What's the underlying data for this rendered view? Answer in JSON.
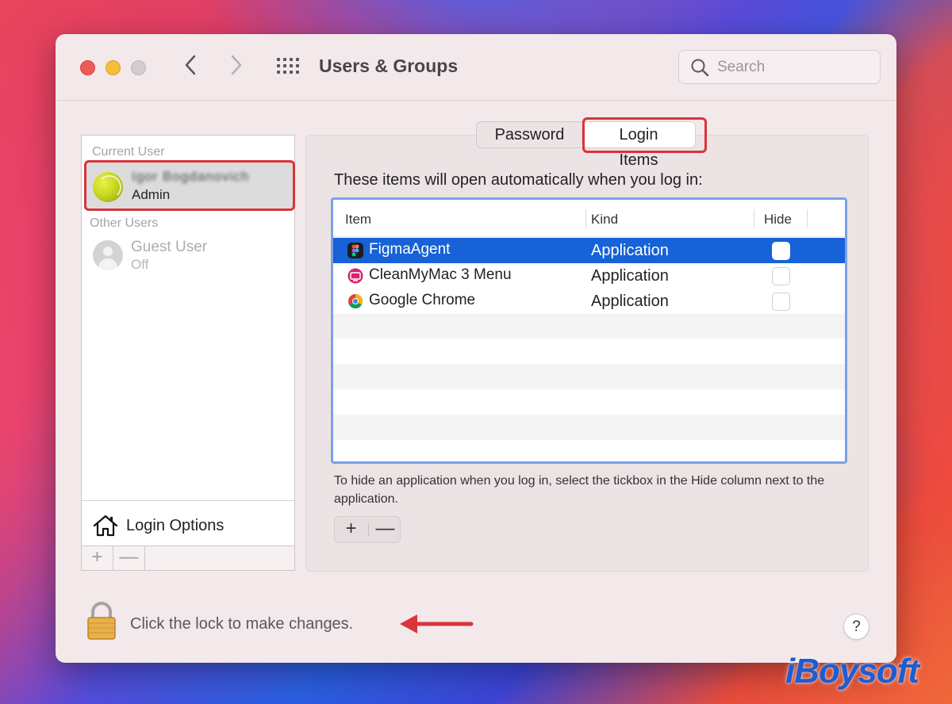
{
  "window": {
    "title": "Users & Groups",
    "search_placeholder": "Search"
  },
  "sidebar": {
    "current_user_heading": "Current User",
    "current_user": {
      "name": "Igor Bogdanovich",
      "role": "Admin"
    },
    "other_users_heading": "Other Users",
    "other_users": [
      {
        "name": "Guest User",
        "state": "Off"
      }
    ],
    "login_options_label": "Login Options",
    "add_label": "+",
    "remove_label": "—"
  },
  "tabs": [
    {
      "label": "Password",
      "selected": false
    },
    {
      "label": "Login Items",
      "selected": true
    }
  ],
  "login_items": {
    "intro": "These items will open automatically when you log in:",
    "columns": {
      "item": "Item",
      "kind": "Kind",
      "hide": "Hide"
    },
    "rows": [
      {
        "name": "FigmaAgent",
        "kind": "Application",
        "hide": false,
        "selected": true,
        "icon": "figma-icon"
      },
      {
        "name": "CleanMyMac 3 Menu",
        "kind": "Application",
        "hide": false,
        "selected": false,
        "icon": "cleanmymac-icon"
      },
      {
        "name": "Google Chrome",
        "kind": "Application",
        "hide": false,
        "selected": false,
        "icon": "chrome-icon"
      }
    ],
    "hint": "To hide an application when you log in, select the tickbox in the Hide column next to the application.",
    "add_label": "+",
    "remove_label": "—"
  },
  "footer": {
    "lock_text": "Click the lock to make changes.",
    "help_label": "?"
  },
  "watermark": "iBoysoft",
  "colors": {
    "selection": "#1662d6",
    "highlight": "#d8343a",
    "close": "#ee5b55",
    "minimize": "#f4bd3a"
  }
}
